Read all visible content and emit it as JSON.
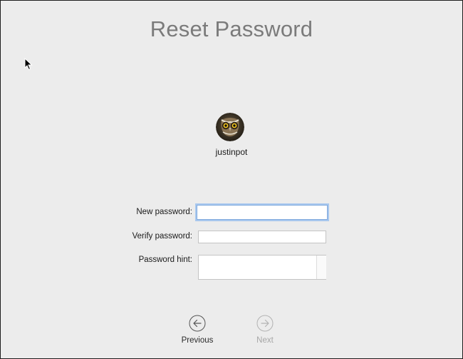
{
  "window": {
    "title": "Reset Password"
  },
  "user": {
    "name": "justinpot",
    "avatar": "owl-avatar"
  },
  "form": {
    "new_password": {
      "label": "New password:",
      "value": ""
    },
    "verify_password": {
      "label": "Verify password:",
      "value": ""
    },
    "password_hint": {
      "label": "Password hint:",
      "value": ""
    }
  },
  "nav": {
    "previous_label": "Previous",
    "next_label": "Next",
    "previous_icon": "arrow-left-circle-icon",
    "next_icon": "arrow-right-circle-icon"
  },
  "colors": {
    "background": "#ececec",
    "title": "#7b7b7b",
    "focus_ring": "#a9c8ee",
    "disabled": "#a6a6a6"
  }
}
